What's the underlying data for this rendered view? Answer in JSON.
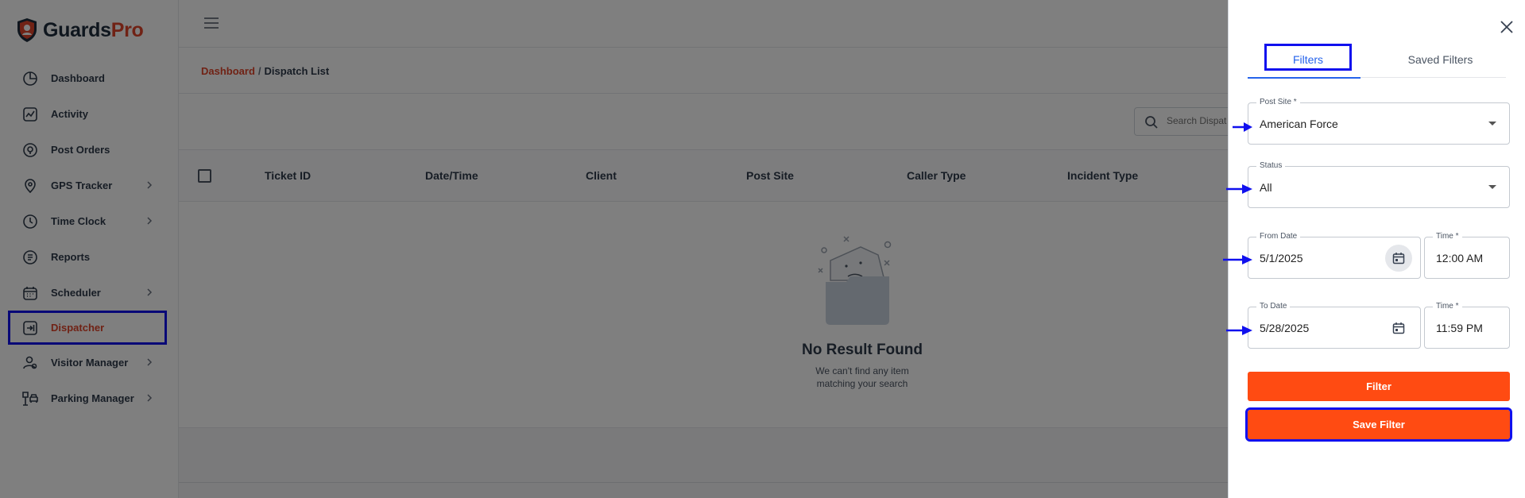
{
  "app": {
    "logo_part1": "Guards",
    "logo_part2": "Pro",
    "brand_color": "#e0452a"
  },
  "sidebar": {
    "items": [
      {
        "label": "Dashboard",
        "icon": "dashboard-icon",
        "chevron": false
      },
      {
        "label": "Activity",
        "icon": "activity-icon",
        "chevron": false
      },
      {
        "label": "Post Orders",
        "icon": "post-orders-icon",
        "chevron": false
      },
      {
        "label": "GPS Tracker",
        "icon": "gps-icon",
        "chevron": true
      },
      {
        "label": "Time Clock",
        "icon": "clock-icon",
        "chevron": true
      },
      {
        "label": "Reports",
        "icon": "reports-icon",
        "chevron": false
      },
      {
        "label": "Scheduler",
        "icon": "calendar-icon",
        "chevron": true
      },
      {
        "label": "Dispatcher",
        "icon": "dispatcher-icon",
        "chevron": false,
        "active": true
      },
      {
        "label": "Visitor Manager",
        "icon": "visitor-icon",
        "chevron": true
      },
      {
        "label": "Parking Manager",
        "icon": "parking-icon",
        "chevron": true
      }
    ]
  },
  "breadcrumb": {
    "root": "Dashboard",
    "separator": "/",
    "current": "Dispatch List"
  },
  "search": {
    "placeholder": "Search Dispat"
  },
  "table": {
    "columns": [
      "Ticket ID",
      "Date/Time",
      "Client",
      "Post Site",
      "Caller Type",
      "Incident Type"
    ]
  },
  "empty_state": {
    "title": "No Result Found",
    "line1": "We can't find any item",
    "line2": "matching your search"
  },
  "drawer": {
    "tabs": {
      "filters": "Filters",
      "saved": "Saved Filters"
    },
    "post_site": {
      "label": "Post Site *",
      "value": "American Force"
    },
    "status": {
      "label": "Status",
      "value": "All"
    },
    "from_date": {
      "label": "From Date",
      "value": "5/1/2025"
    },
    "from_time": {
      "label": "Time *",
      "value": "12:00 AM"
    },
    "to_date": {
      "label": "To Date",
      "value": "5/28/2025"
    },
    "to_time": {
      "label": "Time *",
      "value": "11:59 PM"
    },
    "filter_button": "Filter",
    "save_filter_button": "Save Filter"
  },
  "colors": {
    "accent_button": "#ff4b12",
    "highlight_outline": "#1010ee",
    "tab_active": "#2563eb"
  }
}
